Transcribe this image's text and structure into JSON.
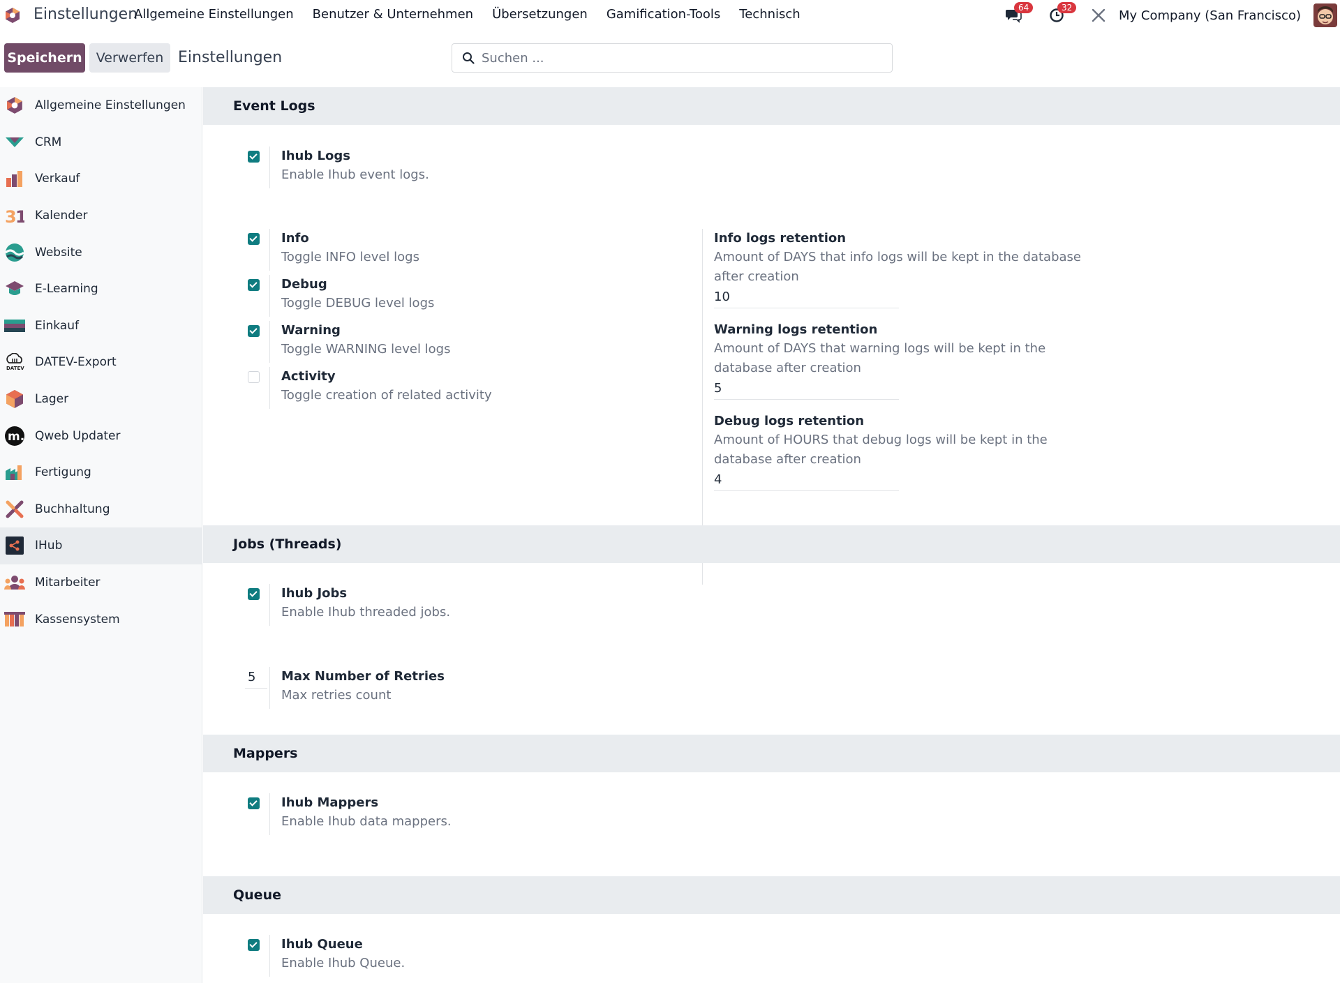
{
  "app": {
    "name": "Einstellungen",
    "menu": [
      "Allgemeine Einstellungen",
      "Benutzer & Unternehmen",
      "Übersetzungen",
      "Gamification-Tools",
      "Technisch"
    ]
  },
  "systray": {
    "messages_count": "64",
    "activities_count": "32",
    "company": "My Company (San Francisco)"
  },
  "control": {
    "save_label": "Speichern",
    "discard_label": "Verwerfen",
    "breadcrumb": "Einstellungen",
    "search_placeholder": "Suchen ..."
  },
  "sidebar": {
    "items": [
      {
        "label": "Allgemeine Einstellungen",
        "icon": "settings-app-icon"
      },
      {
        "label": "CRM",
        "icon": "crm-app-icon"
      },
      {
        "label": "Verkauf",
        "icon": "sales-app-icon"
      },
      {
        "label": "Kalender",
        "icon": "calendar-app-icon"
      },
      {
        "label": "Website",
        "icon": "website-app-icon"
      },
      {
        "label": "E-Learning",
        "icon": "elearning-app-icon"
      },
      {
        "label": "Einkauf",
        "icon": "purchase-app-icon"
      },
      {
        "label": "DATEV-Export",
        "icon": "datev-app-icon"
      },
      {
        "label": "Lager",
        "icon": "inventory-app-icon"
      },
      {
        "label": "Qweb Updater",
        "icon": "qweb-app-icon"
      },
      {
        "label": "Fertigung",
        "icon": "manufacturing-app-icon"
      },
      {
        "label": "Buchhaltung",
        "icon": "accounting-app-icon"
      },
      {
        "label": "IHub",
        "icon": "ihub-app-icon"
      },
      {
        "label": "Mitarbeiter",
        "icon": "employees-app-icon"
      },
      {
        "label": "Kassensystem",
        "icon": "pos-app-icon"
      }
    ],
    "active_index": 12
  },
  "sections": {
    "event_logs": {
      "title": "Event Logs",
      "ihub_logs": {
        "title": "Ihub Logs",
        "desc": "Enable Ihub event logs.",
        "checked": true
      },
      "info": {
        "title": "Info",
        "desc": "Toggle INFO level logs",
        "checked": true
      },
      "debug": {
        "title": "Debug",
        "desc": "Toggle DEBUG level logs",
        "checked": true
      },
      "warning": {
        "title": "Warning",
        "desc": "Toggle WARNING level logs",
        "checked": true
      },
      "activity": {
        "title": "Activity",
        "desc": "Toggle creation of related activity",
        "checked": false
      },
      "info_retention": {
        "title": "Info logs retention",
        "desc": "Amount of DAYS that info logs will be kept in the database after creation",
        "value": "10"
      },
      "warning_retention": {
        "title": "Warning logs retention",
        "desc": "Amount of DAYS that warning logs will be kept in the database after creation",
        "value": "5"
      },
      "debug_retention": {
        "title": "Debug logs retention",
        "desc": "Amount of HOURS that debug logs will be kept in the database after creation",
        "value": "4"
      }
    },
    "jobs": {
      "title": "Jobs (Threads)",
      "ihub_jobs": {
        "title": "Ihub Jobs",
        "desc": "Enable Ihub threaded jobs.",
        "checked": true
      },
      "retries": {
        "title": "Max Number of Retries",
        "desc": "Max retries count",
        "value": "5"
      }
    },
    "mappers": {
      "title": "Mappers",
      "ihub_mappers": {
        "title": "Ihub Mappers",
        "desc": "Enable Ihub data mappers.",
        "checked": true
      }
    },
    "queue": {
      "title": "Queue",
      "ihub_queue": {
        "title": "Ihub Queue",
        "desc": "Enable Ihub Queue.",
        "checked": true
      }
    }
  }
}
